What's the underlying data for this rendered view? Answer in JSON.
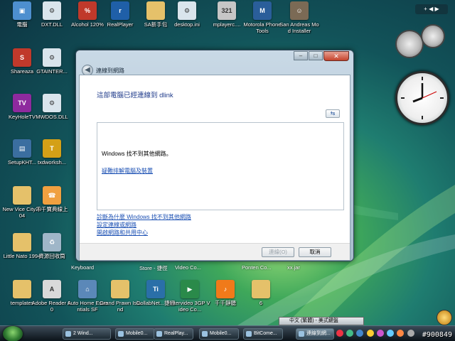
{
  "desktop": {
    "icons": [
      {
        "label": "電腦",
        "name": "computer-icon",
        "color": "#4d8fcf",
        "glyph": "▣"
      },
      {
        "label": "DXT.DLL",
        "name": "dll-file-icon",
        "color": "#d9e4ec",
        "glyph": "⚙"
      },
      {
        "label": "Alcohol 120%",
        "name": "alcohol-icon",
        "color": "#c0392b",
        "glyph": "%"
      },
      {
        "label": "RealPlayer",
        "name": "realplayer-icon",
        "color": "#1f5fa8",
        "glyph": "r"
      },
      {
        "label": "SA新手包",
        "name": "folder-icon",
        "color": "#e5c16a",
        "glyph": ""
      },
      {
        "label": "desktop.ini",
        "name": "ini-file-icon",
        "color": "#d9e4ec",
        "glyph": "⚙"
      },
      {
        "label": "mplayerc....",
        "name": "mplayer-icon",
        "color": "#c6c6c6",
        "glyph": "321"
      },
      {
        "label": "Motorola Phone Tools",
        "name": "motorola-icon",
        "color": "#2a5e9a",
        "glyph": "M"
      },
      {
        "label": "San Andreas Mod Installer",
        "name": "sa-mod-icon",
        "color": "#7b6a55",
        "glyph": "☺"
      },
      {
        "label": "Shareaza",
        "name": "shareaza-icon",
        "color": "#c0392b",
        "glyph": "S"
      },
      {
        "label": "GTAINTER...",
        "name": "dll-file-icon",
        "color": "#d9e4ec",
        "glyph": "⚙"
      },
      {
        "label": "KeyHoleTV",
        "name": "keyholetv-icon",
        "color": "#8e2a9e",
        "glyph": "TV"
      },
      {
        "label": "MWDOS.DLL",
        "name": "dll-file-icon",
        "color": "#d9e4ec",
        "glyph": "⚙"
      },
      {
        "label": "SetupKHT...",
        "name": "setup-icon",
        "color": "#3b6ea0",
        "glyph": "▤"
      },
      {
        "label": "txdworksh...",
        "name": "txd-icon",
        "color": "#d4a017",
        "glyph": "T"
      },
      {
        "label": "New Vice City2004",
        "name": "folder-icon",
        "color": "#e5c16a",
        "glyph": ""
      },
      {
        "label": "千千寶典線上",
        "name": "helpdesk-icon",
        "color": "#f0a040",
        "glyph": "☎"
      },
      {
        "label": "Little Nato 1994",
        "name": "folder-icon",
        "color": "#e5c16a",
        "glyph": ""
      },
      {
        "label": "資源回收筒",
        "name": "recycle-bin-icon",
        "color": "#9fb6c8",
        "glyph": "♻"
      },
      {
        "label": "templates",
        "name": "folder-icon",
        "color": "#e5c16a",
        "glyph": ""
      },
      {
        "label": "Adobe Reader 6.0",
        "name": "adobe-reader-icon",
        "color": "#d9d9d9",
        "glyph": "A"
      },
      {
        "label": "Auto Home Essentials SF",
        "name": "autohome-icon",
        "color": "#5b88b8",
        "glyph": "⌂"
      },
      {
        "label": "Grand Prawn Island",
        "name": "folder-icon",
        "color": "#e5c16a",
        "glyph": ""
      },
      {
        "label": "CollabNet...捷徑",
        "name": "collabnet-icon",
        "color": "#2a6fa8",
        "glyph": "Ti"
      },
      {
        "label": "Intervideo 3GP Video Co...",
        "name": "intervideo-icon",
        "color": "#2a8a4a",
        "glyph": "▶"
      },
      {
        "label": "千千靜聽",
        "name": "ttplayer-icon",
        "color": "#f07a1a",
        "glyph": "♪"
      },
      {
        "label": "6",
        "name": "folder-icon",
        "color": "#e5c16a",
        "glyph": ""
      }
    ],
    "hidden_labels": [
      "Keyboard",
      "Store - 捷徑",
      "Video Co...",
      "Ponten Co...",
      "xx.jar"
    ]
  },
  "dialog": {
    "title": "連線到網路",
    "heading": "這部電腦已經連線到 dlink",
    "refresh_icon": "⇆",
    "panel_message": "Windows 找不到其他網路。",
    "panel_link": "疑難排解電腦及裝置",
    "links": [
      "診斷為什麼 Windows 找不到其他網路",
      "設定連線或網路",
      "開啟網路和共用中心"
    ],
    "buttons": {
      "connect": "連線(O)",
      "cancel": "取消"
    }
  },
  "taskbar": {
    "buttons": [
      "2 Wind...",
      "Mobile0...",
      "RealPlay...",
      "Mobile0...",
      "BitCome...",
      "連線到網..."
    ],
    "active_index": 5
  },
  "language_bar": "中文 (繁體) - 美式鍵盤",
  "sidebar": {
    "controls": "+ ◀ ▶"
  },
  "watermark": "#900849"
}
